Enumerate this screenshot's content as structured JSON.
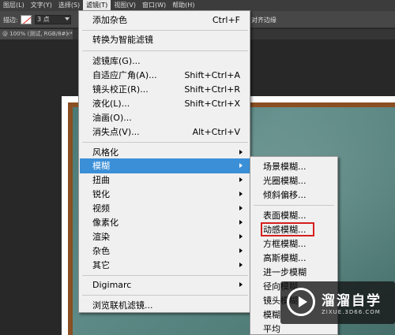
{
  "menubar": {
    "items": [
      "图层(L)",
      "文字(Y)",
      "选择(S)",
      "滤镜(T)",
      "视图(V)",
      "窗口(W)",
      "帮助(H)"
    ],
    "active_index": 3
  },
  "optbar": {
    "stroke_label": "描边:",
    "stroke_value": "3 点",
    "align_edges": "对齐边缘"
  },
  "tab": {
    "title": "@ 100% (测试, RGB/8#) *",
    "close": "×"
  },
  "filter_menu": {
    "items": [
      {
        "label": "添加杂色",
        "shortcut": "Ctrl+F"
      },
      {
        "label": "转换为智能滤镜"
      },
      {
        "label": "滤镜库(G)..."
      },
      {
        "label": "自适应广角(A)...",
        "shortcut": "Shift+Ctrl+A"
      },
      {
        "label": "镜头校正(R)...",
        "shortcut": "Shift+Ctrl+R"
      },
      {
        "label": "液化(L)...",
        "shortcut": "Shift+Ctrl+X"
      },
      {
        "label": "油画(O)..."
      },
      {
        "label": "消失点(V)...",
        "shortcut": "Alt+Ctrl+V"
      },
      {
        "label": "风格化",
        "submenu": true
      },
      {
        "label": "模糊",
        "submenu": true,
        "highlighted": true
      },
      {
        "label": "扭曲",
        "submenu": true
      },
      {
        "label": "锐化",
        "submenu": true
      },
      {
        "label": "视频",
        "submenu": true
      },
      {
        "label": "像素化",
        "submenu": true
      },
      {
        "label": "渲染",
        "submenu": true
      },
      {
        "label": "杂色",
        "submenu": true
      },
      {
        "label": "其它",
        "submenu": true
      },
      {
        "label": "Digimarc",
        "submenu": true
      },
      {
        "label": "浏览联机滤镜..."
      }
    ]
  },
  "blur_submenu": {
    "items": [
      "场景模糊...",
      "光圈模糊...",
      "倾斜偏移...",
      "表面模糊...",
      "动感模糊...",
      "方框模糊...",
      "高斯模糊...",
      "进一步模糊",
      "径向模糊...",
      "镜头模糊...",
      "模糊",
      "平均"
    ],
    "selected_index": 4
  },
  "watermark": {
    "title": "溜溜自学",
    "url": "ZIXUE.3D66.COM"
  },
  "colors": {
    "menu_highlight": "#3a8fd7",
    "menu_bg": "#f0f0f0",
    "red_box": "#d61f1f",
    "board": "#5d8a86",
    "frame": "#8a4f22"
  }
}
